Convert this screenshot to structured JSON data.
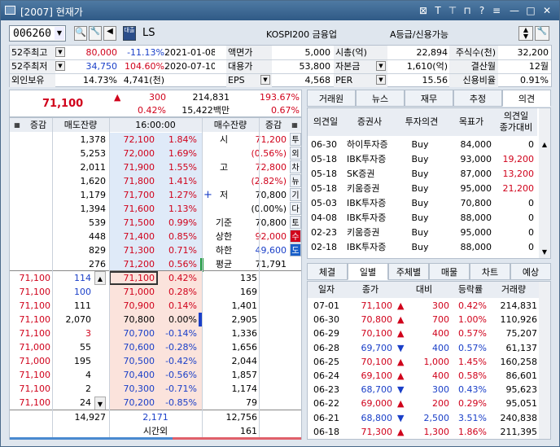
{
  "window": {
    "title": "[2007] 현재가"
  },
  "topbar": {
    "code": "006260",
    "name": "LS",
    "index": "KOSPI200 금융업",
    "grade": "A등급/신용가능",
    "stock_badge": "대출"
  },
  "info": {
    "r1": {
      "l1": "52주최고",
      "v1a": "80,000",
      "v1b": "-11.13%",
      "d1": "2021-01-08",
      "l2": "액면가",
      "v2": "5,000",
      "l3": "시총(억)",
      "v3": "22,894",
      "l4": "주식수(천)",
      "v4": "32,200"
    },
    "r2": {
      "l1": "52주최저",
      "v1a": "34,750",
      "v1b": "104.60%",
      "d1": "2020-07-10",
      "l2": "대용가",
      "v2": "53,800",
      "l3": "자본금",
      "v3": "1,610(억)",
      "l4": "결산월",
      "v4": "12월"
    },
    "r3": {
      "l1": "외인보유",
      "v1a": "14.73%",
      "v1b": "4,741(천)",
      "l2": "EPS",
      "v2": "4,568",
      "l3": "PER",
      "v3": "15.56",
      "l4": "신용비율",
      "v4": "0.91%"
    }
  },
  "price": {
    "current": "71,100",
    "diff": "300",
    "rate": "0.42%",
    "volume": "214,831",
    "amount": "15,422백만",
    "vratio": "193.67%",
    "turnover": "0.67%"
  },
  "ob": {
    "h_l": "증감",
    "h_sell": "매도잔량",
    "h_time": "16:00:00",
    "h_buy": "매수잔량",
    "h_r": "증감",
    "ask": [
      [
        "1,378",
        "72,100",
        "1.84%"
      ],
      [
        "5,253",
        "72,000",
        "1.69%"
      ],
      [
        "2,011",
        "71,900",
        "1.55%"
      ],
      [
        "1,620",
        "71,800",
        "1.41%"
      ],
      [
        "1,179",
        "71,700",
        "1.27%"
      ],
      [
        "1,394",
        "71,600",
        "1.13%"
      ],
      [
        "539",
        "71,500",
        "0.99%"
      ],
      [
        "448",
        "71,400",
        "0.85%"
      ],
      [
        "829",
        "71,300",
        "0.71%"
      ],
      [
        "276",
        "71,200",
        "0.56%"
      ]
    ],
    "bid": [
      [
        "71,100",
        "0.42%",
        "135"
      ],
      [
        "71,000",
        "0.28%",
        "169"
      ],
      [
        "70,900",
        "0.14%",
        "1,401"
      ],
      [
        "70,800",
        "0.00%",
        "2,905"
      ],
      [
        "70,700",
        "-0.14%",
        "1,336"
      ],
      [
        "70,600",
        "-0.28%",
        "1,656"
      ],
      [
        "70,500",
        "-0.42%",
        "2,044"
      ],
      [
        "70,400",
        "-0.56%",
        "1,857"
      ],
      [
        "70,300",
        "-0.71%",
        "1,174"
      ],
      [
        "70,200",
        "-0.85%",
        "79"
      ]
    ],
    "ticks": [
      [
        "71,100",
        "114"
      ],
      [
        "71,100",
        "100"
      ],
      [
        "71,100",
        "111"
      ],
      [
        "71,100",
        "2,070"
      ],
      [
        "71,100",
        "3"
      ],
      [
        "71,000",
        "55"
      ],
      [
        "71,000",
        "195"
      ],
      [
        "71,100",
        "4"
      ],
      [
        "71,100",
        "2"
      ],
      [
        "71,100",
        "24"
      ]
    ],
    "side": {
      "l_si": "시",
      "v_si": "71,200",
      "v_si2": "(0.56%)",
      "l_go": "고",
      "v_go": "72,800",
      "v_go2": "(2.82%)",
      "l_jeo": "저",
      "v_jeo": "70,800",
      "v_jeo2": "(0.00%)",
      "l_gj": "기준",
      "v_gj": "70,800",
      "l_sh": "상한",
      "v_sh": "92,000",
      "l_hh": "하한",
      "v_hh": "49,600",
      "l_pg": "평균",
      "v_pg": "71,791"
    },
    "sidetabs": [
      "투",
      "외",
      "차",
      "뉴",
      "기",
      "다",
      "토",
      "수",
      "도"
    ],
    "total_sell": "14,927",
    "total_diff": "2,171",
    "total_buy": "12,756",
    "after_label": "시간외",
    "after_val": "161"
  },
  "right_tabs": [
    "거래원",
    "뉴스",
    "재무",
    "추정",
    "의견"
  ],
  "opinion": {
    "headers": [
      "의견일",
      "증권사",
      "투자의견",
      "목표가",
      "의견일\n종가대비"
    ],
    "rows": [
      [
        "06-30",
        "하이투자증",
        "Buy",
        "84,000",
        "0"
      ],
      [
        "05-18",
        "IBK투자증",
        "Buy",
        "93,000",
        "19,200"
      ],
      [
        "05-18",
        "SK증권",
        "Buy",
        "87,000",
        "13,200"
      ],
      [
        "05-18",
        "키움증권",
        "Buy",
        "95,000",
        "21,200"
      ],
      [
        "05-03",
        "IBK투자증",
        "Buy",
        "70,800",
        "0"
      ],
      [
        "04-08",
        "IBK투자증",
        "Buy",
        "88,000",
        "0"
      ],
      [
        "02-23",
        "키움증권",
        "Buy",
        "95,000",
        "0"
      ],
      [
        "02-18",
        "IBK투자증",
        "Buy",
        "88,000",
        "0"
      ]
    ]
  },
  "bottom_tabs": [
    "체결",
    "일별",
    "주체별",
    "매물",
    "차트",
    "예상"
  ],
  "daily": {
    "headers": [
      "일자",
      "종가",
      "대비",
      "등락률",
      "거래량"
    ],
    "rows": [
      [
        "07-01",
        "71,100",
        "up",
        "300",
        "0.42%",
        "214,831"
      ],
      [
        "06-30",
        "70,800",
        "up",
        "700",
        "1.00%",
        "110,926"
      ],
      [
        "06-29",
        "70,100",
        "up",
        "400",
        "0.57%",
        "75,207"
      ],
      [
        "06-28",
        "69,700",
        "down",
        "400",
        "0.57%",
        "61,137"
      ],
      [
        "06-25",
        "70,100",
        "up",
        "1,000",
        "1.45%",
        "160,258"
      ],
      [
        "06-24",
        "69,100",
        "up",
        "400",
        "0.58%",
        "86,601"
      ],
      [
        "06-23",
        "68,700",
        "down",
        "300",
        "0.43%",
        "95,623"
      ],
      [
        "06-22",
        "69,000",
        "up",
        "200",
        "0.29%",
        "95,051"
      ],
      [
        "06-21",
        "68,800",
        "down",
        "2,500",
        "3.51%",
        "240,838"
      ],
      [
        "06-18",
        "71,300",
        "up",
        "1,300",
        "1.86%",
        "211,395"
      ]
    ]
  },
  "colors": {
    "ask_bg": "#dfeaf8",
    "bid_bg": "#fbe3dc",
    "red": "#d0021b",
    "blue": "#1a3fc8"
  }
}
